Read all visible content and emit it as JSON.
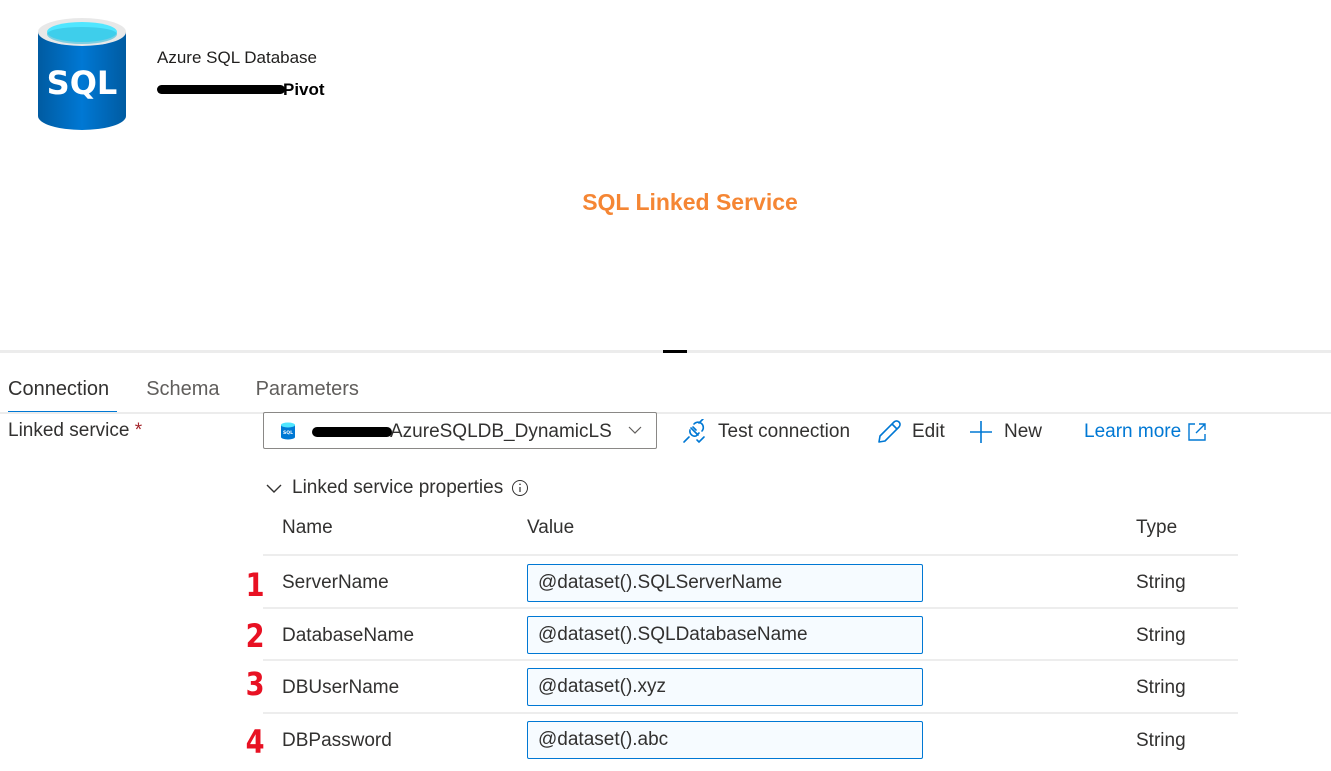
{
  "header": {
    "resource_type": "Azure SQL Database",
    "dataset_name_visible": "Pivot",
    "logo_text": "SQL"
  },
  "annotation": {
    "text": "SQL Linked Service",
    "color": "#f58634"
  },
  "tabs": [
    {
      "label": "Connection",
      "active": true
    },
    {
      "label": "Schema",
      "active": false
    },
    {
      "label": "Parameters",
      "active": false
    }
  ],
  "linked_service": {
    "label": "Linked service",
    "required_mark": "*",
    "selected_value_visible": "AzureSQLDB_DynamicLS",
    "icon": "sql-database-icon"
  },
  "toolbar": {
    "test_connection": "Test connection",
    "edit": "Edit",
    "new": "New",
    "learn_more": "Learn more"
  },
  "properties": {
    "toggle_label": "Linked service properties",
    "expanded": true,
    "columns": {
      "name": "Name",
      "value": "Value",
      "type": "Type"
    },
    "rows": [
      {
        "marker": "1",
        "name": "ServerName",
        "value": "@dataset().SQLServerName",
        "type": "String"
      },
      {
        "marker": "2",
        "name": "DatabaseName",
        "value": "@dataset().SQLDatabaseName",
        "type": "String"
      },
      {
        "marker": "3",
        "name": "DBUserName",
        "value": "@dataset().xyz",
        "type": "String"
      },
      {
        "marker": "4",
        "name": "DBPassword",
        "value": "@dataset().abc",
        "type": "String"
      }
    ]
  },
  "colors": {
    "accent": "#0078d4",
    "annotation": "#f58634",
    "required": "#a4262c",
    "marker": "#e81123"
  }
}
